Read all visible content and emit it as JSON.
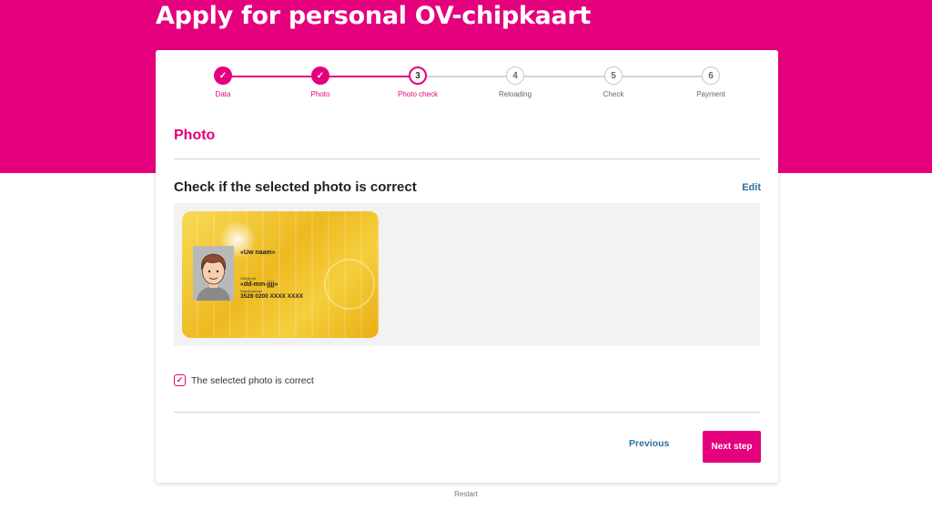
{
  "header": {
    "title": "Apply for personal OV-chipkaart"
  },
  "stepper": {
    "steps": [
      {
        "marker": "✓",
        "label": "Data",
        "state": "done"
      },
      {
        "marker": "✓",
        "label": "Photo",
        "state": "done"
      },
      {
        "marker": "3",
        "label": "Photo check",
        "state": "current"
      },
      {
        "marker": "4",
        "label": "Reloading",
        "state": "todo"
      },
      {
        "marker": "5",
        "label": "Check",
        "state": "todo"
      },
      {
        "marker": "6",
        "label": "Payment",
        "state": "todo"
      }
    ]
  },
  "section": {
    "title": "Photo",
    "check_title": "Check if the selected photo is correct",
    "edit_label": "Edit"
  },
  "card_preview": {
    "name": "«Uw naam»",
    "date_caption": "Geldig tot",
    "date": "«dd-mm-jjjj»",
    "number_caption": "Kaartnummer",
    "number": "3528 0200 XXXX XXXX"
  },
  "confirm": {
    "label": "The selected photo is correct",
    "checked": true
  },
  "actions": {
    "previous_label": "Previous",
    "next_label": "Next step"
  },
  "footer": {
    "restart_label": "Restart"
  },
  "colors": {
    "brand": "#e5007d",
    "link": "#2e6fa0",
    "card_gold": "#eeb921"
  },
  "icons": {
    "completed_step": "check-icon",
    "confirm_checkbox": "check-icon"
  }
}
